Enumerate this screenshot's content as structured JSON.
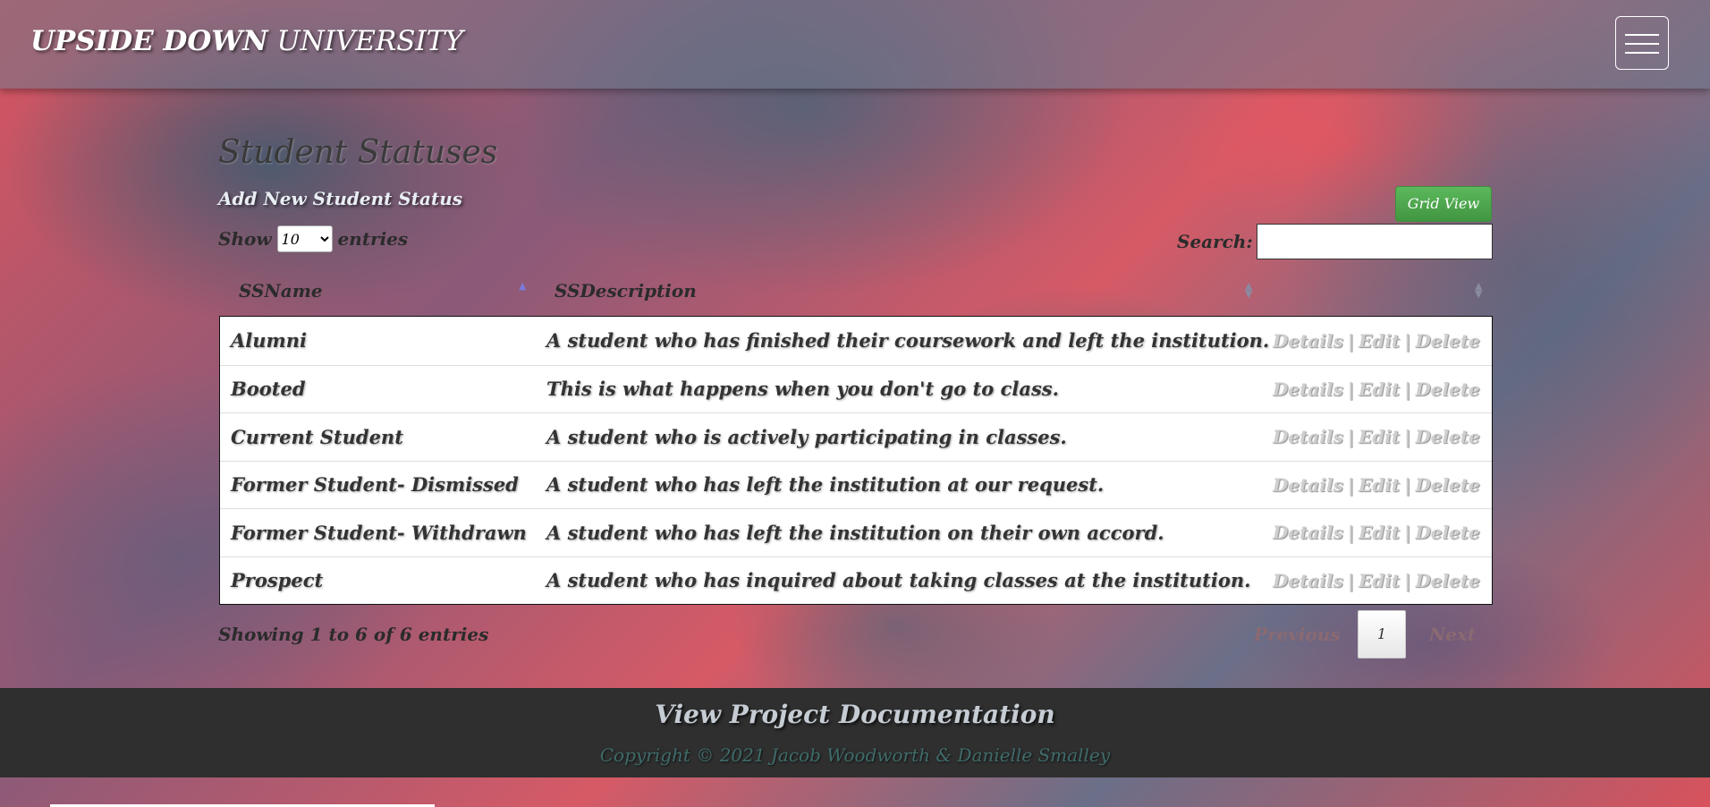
{
  "navbar": {
    "brand_bold": "UPSIDE DOWN",
    "brand_light": "UNIVERSITY",
    "menu_icon": "hamburger-icon"
  },
  "page": {
    "title": "Student Statuses",
    "add_link": "Add New Student Status",
    "grid_view_button": "Grid View"
  },
  "length_control": {
    "show_label": "Show",
    "selected": "10",
    "entries_label": "entries"
  },
  "search": {
    "label": "Search:",
    "value": ""
  },
  "table": {
    "columns": [
      "SSName",
      "SSDescription",
      ""
    ],
    "sort_icon": "sort-icon",
    "action_labels": {
      "details": "Details",
      "edit": "Edit",
      "delete": "Delete",
      "separator": "|"
    },
    "rows": [
      {
        "name": "Alumni",
        "description": "A student who has finished their coursework and left the institution."
      },
      {
        "name": "Booted",
        "description": "This is what happens when you don't go to class."
      },
      {
        "name": "Current Student",
        "description": "A student who is actively participating in classes."
      },
      {
        "name": "Former Student- Dismissed",
        "description": "A student who has left the institution at our request."
      },
      {
        "name": "Former Student- Withdrawn",
        "description": "A student who has left the institution on their own accord."
      },
      {
        "name": "Prospect",
        "description": "A student who has inquired about taking classes at the institution."
      }
    ]
  },
  "pagination": {
    "info": "Showing 1 to 6 of 6 entries",
    "previous": "Previous",
    "current_page": "1",
    "next": "Next"
  },
  "footer": {
    "doc_link": "View Project Documentation",
    "copyright": "Copyright © 2021 Jacob Woodworth & Danielle Smalley"
  },
  "colors": {
    "grid_button": "#5cb85c",
    "footer_bg": "#2f2f2f",
    "action_link": "#cfcfcf"
  }
}
